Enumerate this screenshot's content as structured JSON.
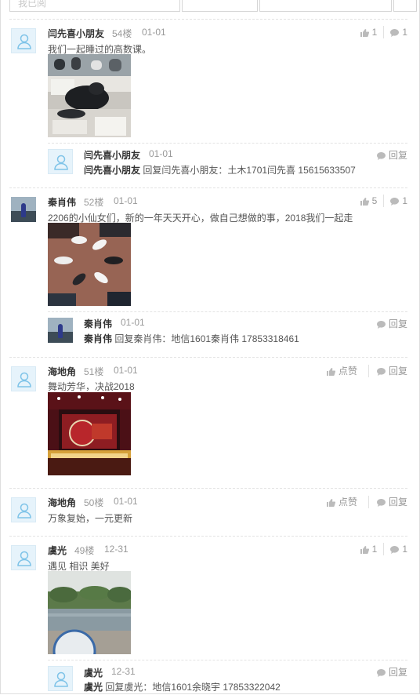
{
  "topbar": {
    "first_label": "我已阅"
  },
  "posts": [
    {
      "name": "闫先喜小朋友",
      "floor": "54楼",
      "date": "01-01",
      "text": "我们一起睡过的高数课。",
      "likes": "1",
      "comments": "1",
      "reply": {
        "name": "闫先喜小朋友",
        "date": "01-01",
        "prefix": "闫先喜小朋友",
        "body": "回复闫先喜小朋友：土木1701闫先喜 15615633507",
        "btn": "回复"
      }
    },
    {
      "name": "秦肖伟",
      "floor": "52楼",
      "date": "01-01",
      "text": "2206的小仙女们，新的一年天天开心，做自己想做的事，2018我们一起走",
      "likes": "5",
      "comments": "1",
      "reply": {
        "name": "秦肖伟",
        "date": "01-01",
        "prefix": "秦肖伟",
        "body": "回复秦肖伟：地信1601秦肖伟 17853318461",
        "btn": "回复"
      }
    },
    {
      "name": "海地角",
      "floor": "51楼",
      "date": "01-01",
      "text": "舞动芳华，决战2018",
      "likes": "点赞",
      "comments": "回复"
    },
    {
      "name": "海地角",
      "floor": "50楼",
      "date": "01-01",
      "text": "万象复始，一元更新",
      "likes": "点赞",
      "comments": "回复"
    },
    {
      "name": "虞光",
      "floor": "49楼",
      "date": "12-31",
      "text": "遇见 相识 美好",
      "likes": "1",
      "comments": "1",
      "reply": {
        "name": "虞光",
        "date": "12-31",
        "prefix": "虞光",
        "body": "回复虞光：地信1601余晓宇 17853322042",
        "btn": "回复"
      }
    }
  ],
  "colors": {
    "accent": "#2b8cd0",
    "muted": "#999999",
    "avatar_bg": "#e6f3fb"
  }
}
